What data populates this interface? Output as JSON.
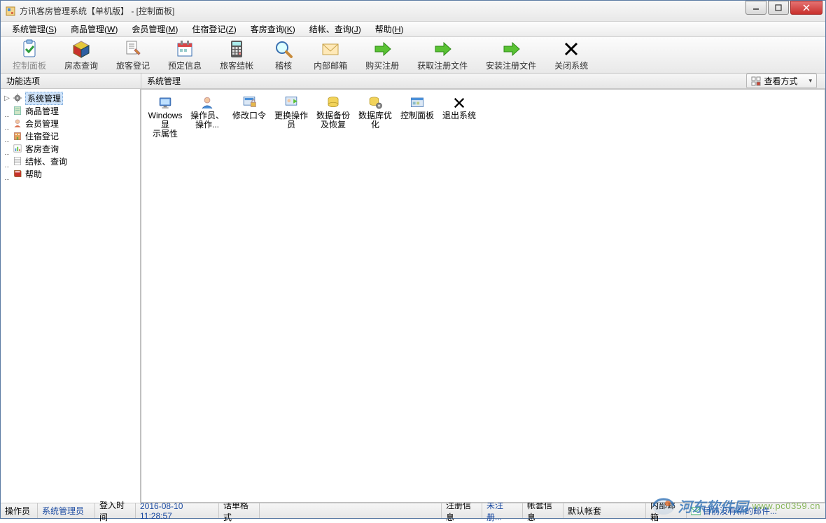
{
  "title": "方讯客房管理系统【单机版】 - [控制面板]",
  "menus": [
    {
      "label": "系统管理",
      "key": "S"
    },
    {
      "label": "商品管理",
      "key": "W"
    },
    {
      "label": "会员管理",
      "key": "M"
    },
    {
      "label": "住宿登记",
      "key": "Z"
    },
    {
      "label": "客房查询",
      "key": "K"
    },
    {
      "label": "结帐、查询",
      "key": "J"
    },
    {
      "label": "帮助",
      "key": "H"
    }
  ],
  "toolbar": [
    {
      "label": "控制面板",
      "icon": "clipboard-check",
      "active": true
    },
    {
      "label": "房态查询",
      "icon": "cube-red"
    },
    {
      "label": "旅客登记",
      "icon": "doc-pen"
    },
    {
      "label": "预定信息",
      "icon": "calendar"
    },
    {
      "label": "旅客结帐",
      "icon": "calculator"
    },
    {
      "label": "稽核",
      "icon": "magnifier"
    },
    {
      "label": "内部邮箱",
      "icon": "envelope"
    },
    {
      "label": "购买注册",
      "icon": "arrow-green"
    },
    {
      "label": "获取注册文件",
      "icon": "arrow-green"
    },
    {
      "label": "安装注册文件",
      "icon": "arrow-green"
    },
    {
      "label": "关闭系统",
      "icon": "x-black"
    }
  ],
  "panels": {
    "left": "功能选项",
    "right": "系统管理"
  },
  "view_mode": "查看方式",
  "tree": [
    {
      "label": "系统管理",
      "icon": "gear",
      "selected": true,
      "expander": "▷"
    },
    {
      "label": "商品管理",
      "icon": "note"
    },
    {
      "label": "会员管理",
      "icon": "user"
    },
    {
      "label": "住宿登记",
      "icon": "hotel"
    },
    {
      "label": "客房查询",
      "icon": "chart"
    },
    {
      "label": "结帐、查询",
      "icon": "sheet"
    },
    {
      "label": "帮助",
      "icon": "book"
    }
  ],
  "content_items": [
    {
      "label1": "Windows显",
      "label2": "示属性",
      "icon": "monitor"
    },
    {
      "label1": "操作员、",
      "label2": "操作...",
      "icon": "person"
    },
    {
      "label1": "修改口令",
      "label2": "",
      "icon": "lock"
    },
    {
      "label1": "更换操作",
      "label2": "员",
      "icon": "swap"
    },
    {
      "label1": "数据备份",
      "label2": "及恢复",
      "icon": "db-yellow"
    },
    {
      "label1": "数据库优",
      "label2": "化",
      "icon": "db-gear"
    },
    {
      "label1": "控制面板",
      "label2": "",
      "icon": "panel"
    },
    {
      "label1": "退出系统",
      "label2": "",
      "icon": "x-black"
    }
  ],
  "status": {
    "operator_label": "操作员",
    "operator_value": "系统管理员",
    "login_time_label": "登入时间",
    "login_time_value": "2016-08-10 11:28:57",
    "ticket_format_label": "话单格式",
    "reg_info_label": "注册信息",
    "reg_info_value": "未注册...",
    "account_label": "帐套信息",
    "account_value": "默认帐套",
    "mailbox_label": "内部邮箱",
    "mailbox_value": "目前没有新的邮件..."
  },
  "watermark": {
    "title": "河东软件园",
    "url": "www.pc0359.cn"
  }
}
